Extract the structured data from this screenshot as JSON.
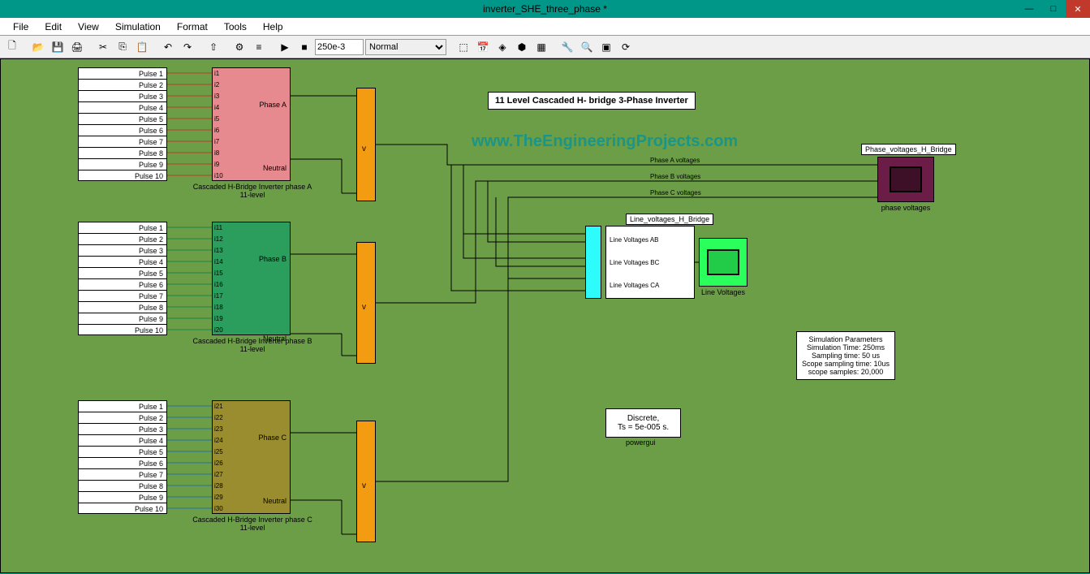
{
  "window": {
    "title": "inverter_SHE_three_phase *"
  },
  "menu": {
    "file": "File",
    "edit": "Edit",
    "view": "View",
    "simulation": "Simulation",
    "format": "Format",
    "tools": "Tools",
    "help": "Help"
  },
  "toolbar": {
    "stop_time": "250e-3",
    "mode": "Normal"
  },
  "diagram": {
    "title": "11 Level Cascaded H- bridge 3-Phase Inverter",
    "watermark": "www.TheEngineeringProjects.com",
    "pulses": [
      "Pulse 1",
      "Pulse 2",
      "Pulse 3",
      "Pulse 4",
      "Pulse 5",
      "Pulse 6",
      "Pulse 7",
      "Pulse 8",
      "Pulse 9",
      "Pulse 10"
    ],
    "hbridge_a": {
      "label": "Cascaded H-Bridge Inverter phase A\n11-level",
      "inputs": [
        "i1",
        "i2",
        "i3",
        "i4",
        "i5",
        "i6",
        "i7",
        "i8",
        "i9",
        "i10"
      ],
      "out1": "Phase A",
      "out2": "Neutral"
    },
    "hbridge_b": {
      "label": "Cascaded H-Bridge Inverter phase B\n11-level",
      "inputs": [
        "i11",
        "i12",
        "i13",
        "i14",
        "i15",
        "i16",
        "i17",
        "i18",
        "i19",
        "i20"
      ],
      "out1": "Phase B",
      "out2": "Neutral"
    },
    "hbridge_c": {
      "label": "Cascaded H-Bridge Inverter phase C\n11-level",
      "inputs": [
        "i21",
        "i22",
        "i23",
        "i24",
        "i25",
        "i26",
        "i27",
        "i28",
        "i29",
        "i30"
      ],
      "out1": "Phase C",
      "out2": "Neutral"
    },
    "v_label": "v",
    "phase_signals": {
      "a": "Phase A voltages",
      "b": "Phase B voltages",
      "c": "Phase C voltages"
    },
    "line_voltages": {
      "title": "Line_voltages_H_Bridge",
      "ab": "Line Voltages AB",
      "bc": "Line Voltages BC",
      "ca": "Line Voltages CA",
      "scope_label": "Line Voltages"
    },
    "phase_scope": {
      "title": "Phase_voltages_H_Bridge",
      "label": "phase voltages"
    },
    "powergui": {
      "line1": "Discrete,",
      "line2": "Ts = 5e-005 s.",
      "label": "powergui"
    },
    "sim_params": {
      "l1": "Simulation Parameters",
      "l2": "Simulation Time: 250ms",
      "l3": "Sampling time: 50 us",
      "l4": "Scope sampling time: 10us",
      "l5": "scope samples: 20,000"
    }
  }
}
